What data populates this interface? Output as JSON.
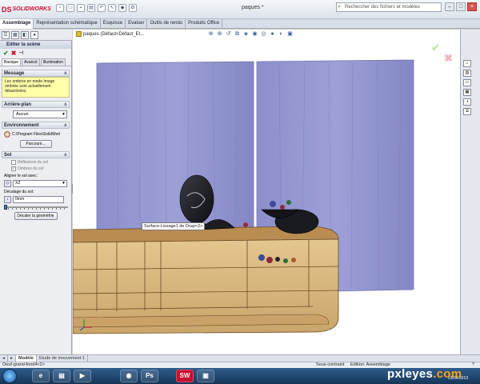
{
  "app": {
    "logo_text": "SOLIDWORKS",
    "doc_title": "paques *",
    "search_placeholder": "Rechercher des fichiers et modèles"
  },
  "command_tabs": [
    "Assemblage",
    "Représentation schématique",
    "Esquisse",
    "Evaluer",
    "Outils de rendu",
    "Produits Office"
  ],
  "panel": {
    "title": "Editer la scène",
    "tabs": [
      "Basique",
      "Avancé",
      "Illumination"
    ],
    "message": {
      "header": "Message",
      "text": "Les ombres en mode Image ombrée sont actuellement désactivées."
    },
    "background": {
      "header": "Arrière-plan",
      "value": "Aucun"
    },
    "environment": {
      "header": "Environnement",
      "path": "C:\\Program Files\\SolidWorl",
      "browse": "Parcourir..."
    },
    "floor": {
      "header": "Sol",
      "reflections": "Réflexions du sol",
      "shadows": "Ombres du sol",
      "align_label": "Aligner le sol avec:",
      "align_value": "XZ",
      "offset_label": "Décalage du sol:",
      "offset_value": "0mm",
      "flip_button": "Décaler la géométrie"
    }
  },
  "graphics": {
    "breadcrumb": "paques (Défaut<Défaut_Et...",
    "tooltip": "Surface-Lissage1 de Drap<2>"
  },
  "bottom_tabs": [
    "Modèle",
    "Etude de mouvement 1"
  ],
  "status": {
    "left": "Oeuf-grand-fond4<2>",
    "mid1": "Sous-contraint",
    "mid2": "Edition: Assemblage",
    "help": "?"
  },
  "taskbar": {
    "date": "01/04/2013"
  },
  "watermark": {
    "text": "pxleyes",
    "suffix": ".com"
  },
  "colors": {
    "curtain": "#8f92cc",
    "cabinet": "#d8b67e",
    "message_bg": "#ffffa8",
    "accent_red": "#c8102e"
  }
}
